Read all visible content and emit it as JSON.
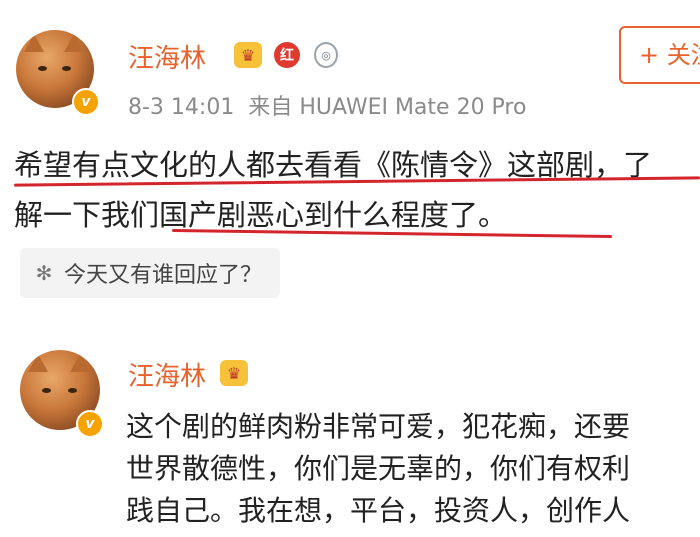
{
  "post": {
    "author": "汪海林",
    "badge_red_text": "红",
    "badge_crown_text": "♛",
    "badge_medal_text": "◎",
    "time": "8-3 14:01",
    "source": "来自 HUAWEI Mate 20 Pro",
    "follow_label": "+ 关注",
    "lines": [
      "希望有点文化的人都去看看《陈情令》这部剧，了",
      "解一下我们国产剧恶心到什么程度了。"
    ],
    "reply_prompt": "今天又有谁回应了？",
    "verified_mark": "v"
  },
  "repost": {
    "author": "汪海林",
    "verified_mark": "v",
    "lines": [
      "这个剧的鲜肉粉非常可爱，犯花痴，还要",
      "世界散德性，你们是无辜的，你们有权利",
      "践自己。我在想，平台，投资人，创作人"
    ]
  },
  "colors": {
    "name": "#e8632b",
    "underline": "#d3262c",
    "meta": "#8a8a8a"
  }
}
